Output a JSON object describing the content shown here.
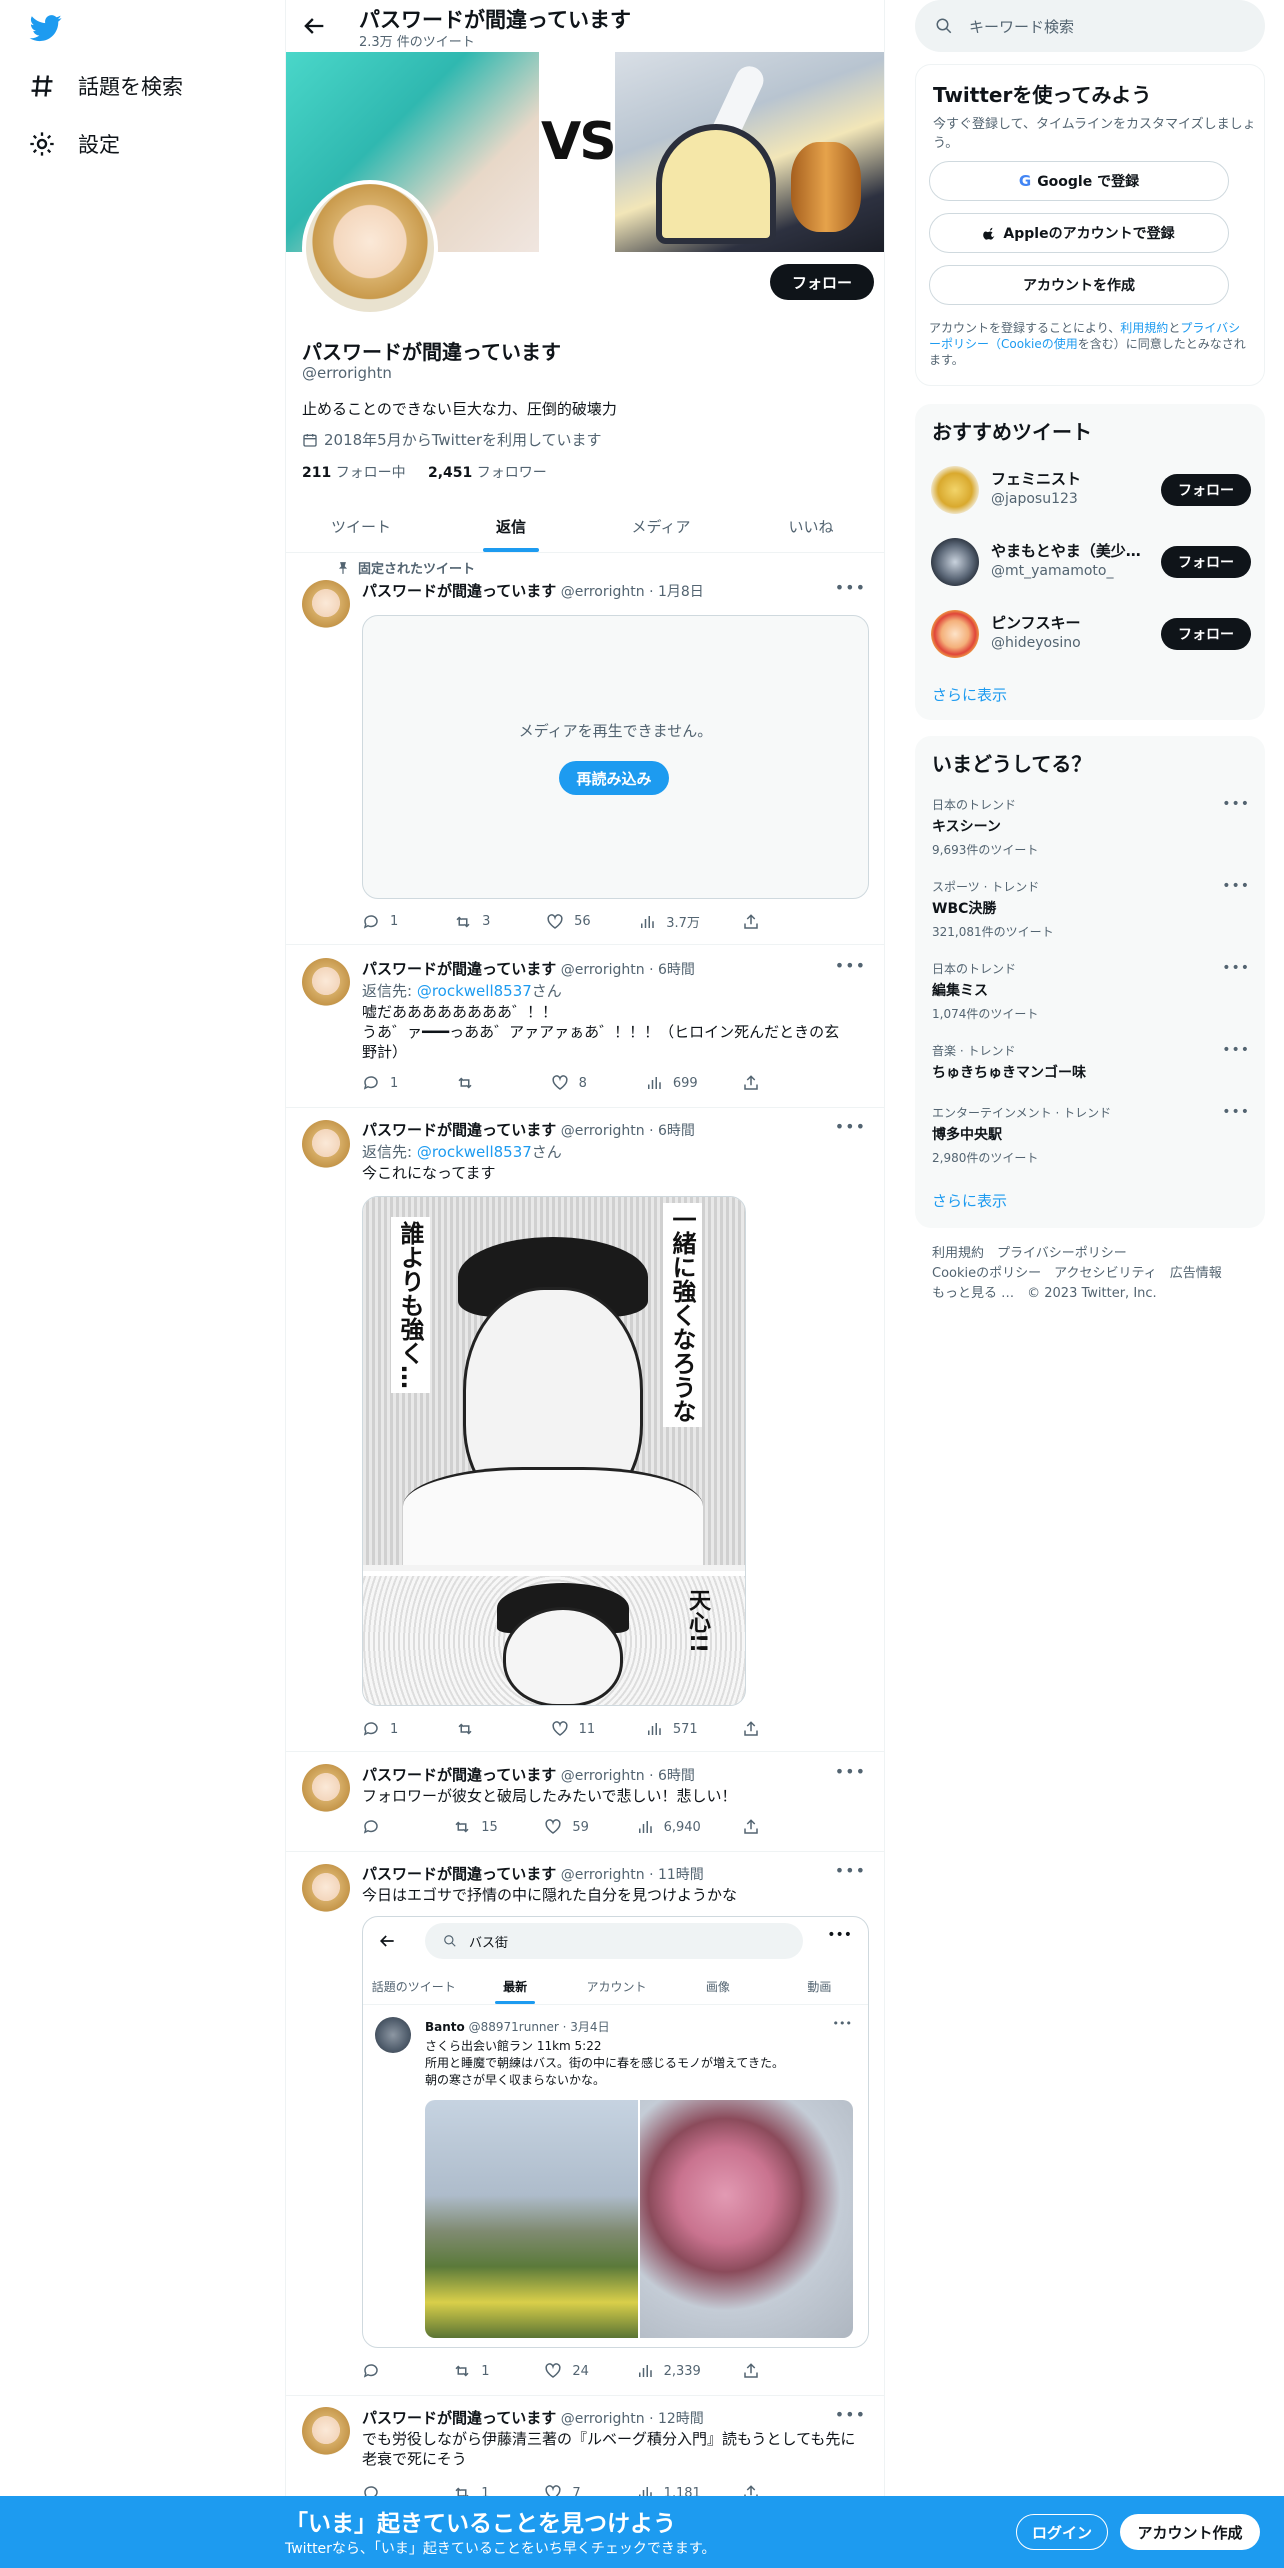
{
  "nav": {
    "items": [
      {
        "label": "話題を検索",
        "icon": "hashtag-icon"
      },
      {
        "label": "設定",
        "icon": "gear-icon"
      }
    ]
  },
  "header": {
    "title": "パスワードが間違っています",
    "tweet_count": "2.3万 件のツイート"
  },
  "banner": {
    "vs_text": "VS"
  },
  "profile": {
    "follow_label": "フォロー",
    "name": "パスワードが間違っています",
    "handle": "@errorightn",
    "bio": "止めることのできない巨大な力、圧倒的破壊力",
    "joined": "2018年5月からTwitterを利用しています",
    "following_count": "211",
    "following_label": "フォロー中",
    "followers_count": "2,451",
    "followers_label": "フォロワー"
  },
  "tabs": [
    {
      "label": "ツイート",
      "active": false
    },
    {
      "label": "返信",
      "active": true
    },
    {
      "label": "メディア",
      "active": false
    },
    {
      "label": "いいね",
      "active": false
    }
  ],
  "tweets": [
    {
      "pinned_label": "固定されたツイート",
      "name": "パスワードが間違っています",
      "meta": "@errorightn · 1月8日",
      "media_message": "メディアを再生できません。",
      "reload_label": "再読み込み",
      "replies": "1",
      "retweets": "3",
      "likes": "56",
      "views": "3.7万"
    },
    {
      "name": "パスワードが間違っています",
      "meta": "@errorightn · 6時間",
      "reply_prefix": "返信先: ",
      "reply_to": "@rockwell8537",
      "reply_suffix": "さん",
      "text_lines": [
        "嘘だああああああああ゛！！",
        "うあ゛ァ━━━っああ゛アァアァぁあ゛！！！（ヒロイン死んだときの玄",
        "野計）"
      ],
      "replies": "1",
      "retweets": "",
      "likes": "8",
      "views": "699"
    },
    {
      "name": "パスワードが間違っています",
      "meta": "@errorightn · 6時間",
      "reply_prefix": "返信先: ",
      "reply_to": "@rockwell8537",
      "reply_suffix": "さん",
      "text": "今これになってます",
      "manga_text_1": "一緒に強くなろうな",
      "manga_text_2": "誰よりも強く…",
      "manga_text_3": "天心!!",
      "replies": "1",
      "retweets": "",
      "likes": "11",
      "views": "571"
    },
    {
      "name": "パスワードが間違っています",
      "meta": "@errorightn · 6時間",
      "text": "フォロワーが彼女と破局したみたいで悲しい！悲しい！",
      "replies": "",
      "retweets": "15",
      "likes": "59",
      "views": "6,940"
    },
    {
      "name": "パスワードが間違っています",
      "meta": "@errorightn · 11時間",
      "text": "今日はエゴサで抒情の中に隠れた自分を見つけようかな",
      "replies": "",
      "retweets": "1",
      "likes": "24",
      "views": "2,339"
    },
    {
      "name": "パスワードが間違っています",
      "meta": "@errorightn · 12時間",
      "text_lines": [
        "でも労役しながら伊藤清三著の『ルベーグ積分入門』読もうとしても先に",
        "老衰で死にそう"
      ],
      "replies": "",
      "retweets": "1",
      "likes": "7",
      "views": "1,181"
    }
  ],
  "quote": {
    "search_value": "バス街",
    "tabs": [
      {
        "label": "話題のツイート",
        "active": false
      },
      {
        "label": "最新",
        "active": true
      },
      {
        "label": "アカウント",
        "active": false
      },
      {
        "label": "画像",
        "active": false
      },
      {
        "label": "動画",
        "active": false
      }
    ],
    "name": "Banto",
    "meta": "@88971runner · 3月4日",
    "lines": [
      "さくら出会い館ラン 11km 5:22",
      "所用と睡魔で朝練はバス。街の中に春を感じるモノが増えてきた。",
      "朝の寒さが早く収まらないかな。"
    ]
  },
  "right": {
    "search_placeholder": "キーワード検索",
    "signup": {
      "title": "Twitterを使ってみよう",
      "subtitle": "今すぐ登録して、タイムラインをカスタマイズしましょう。",
      "google": "Google で登録",
      "apple": "Appleのアカウントで登録",
      "create": "アカウントを作成",
      "terms_1": "アカウントを登録することにより、",
      "terms_link_1": "利用規約",
      "terms_2": "と",
      "terms_link_2": "プライバシーポリシー（Cookieの使用",
      "terms_3": "を含む）に同意したとみなされます。"
    },
    "recs": {
      "title": "おすすめツイート",
      "items": [
        {
          "name": "フェミニスト",
          "handle": "@japosu123",
          "follow": "フォロー"
        },
        {
          "name": "やまもとやま（美少女）",
          "handle": "@mt_yamamoto_",
          "follow": "フォロー"
        },
        {
          "name": "ピンフスキー",
          "handle": "@hideyosino",
          "follow": "フォロー"
        }
      ],
      "more": "さらに表示"
    },
    "trends": {
      "title": "いまどうしてる？",
      "items": [
        {
          "category": "日本のトレンド",
          "name": "キスシーン",
          "count": "9,693件のツイート"
        },
        {
          "category": "スポーツ · トレンド",
          "name": "WBC決勝",
          "count": "321,081件のツイート"
        },
        {
          "category": "日本のトレンド",
          "name": "編集ミス",
          "count": "1,074件のツイート"
        },
        {
          "category": "音楽 · トレンド",
          "name": "ちゅきちゅきマンゴー味",
          "count": ""
        },
        {
          "category": "エンターテインメント · トレンド",
          "name": "博多中央駅",
          "count": "2,980件のツイート"
        }
      ],
      "more": "さらに表示"
    },
    "footer": {
      "line1": "利用規約　プライバシーポリシー",
      "line2": "Cookieのポリシー　アクセシビリティ　広告情報",
      "line3": "もっと見る …　© 2023 Twitter, Inc."
    }
  },
  "bottombar": {
    "title": "「いま」起きていることを見つけよう",
    "subtitle": "Twitterなら、「いま」起きていることをいち早くチェックできます。",
    "login": "ログイン",
    "signup": "アカウント作成"
  },
  "colors": {
    "accent": "#1d9bf0",
    "text": "#0f1419",
    "muted": "#536471"
  }
}
